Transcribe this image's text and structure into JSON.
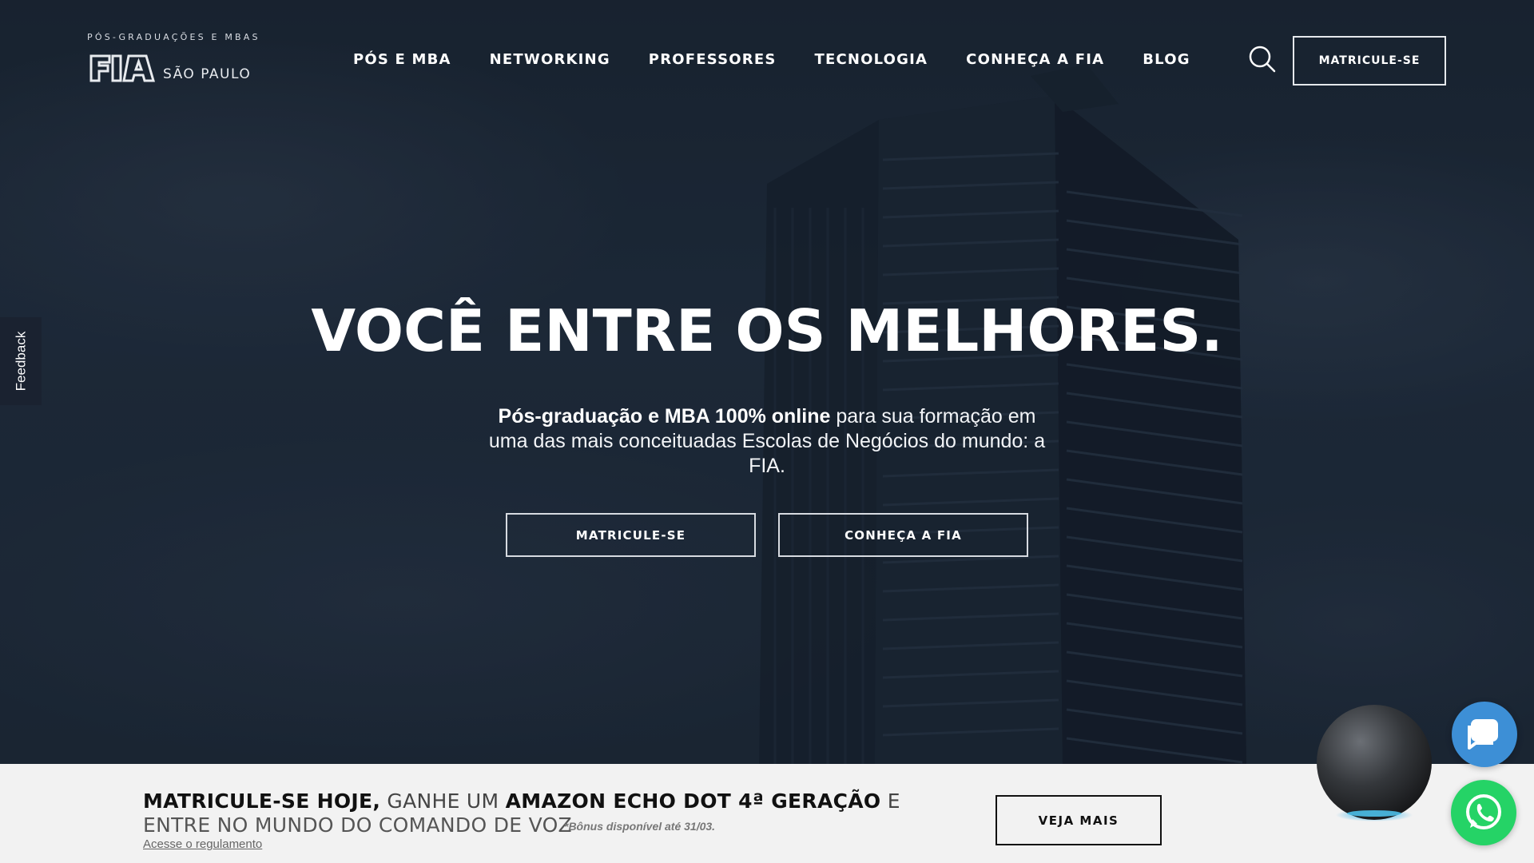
{
  "header": {
    "logo": {
      "tagline": "PÓS-GRADUAÇÕES E MBAS",
      "mark": "FIA",
      "city": "SÃO PAULO"
    },
    "nav": [
      {
        "label": "PÓS E MBA"
      },
      {
        "label": "NETWORKING"
      },
      {
        "label": "PROFESSORES"
      },
      {
        "label": "TECNOLOGIA"
      },
      {
        "label": "CONHEÇA A FIA"
      },
      {
        "label": "BLOG"
      }
    ],
    "cta_label": "MATRICULE-SE"
  },
  "feedback_label": "Feedback",
  "hero": {
    "title": "VOCÊ ENTRE OS MELHORES.",
    "subtitle_bold": "Pós-graduação e MBA 100% online",
    "subtitle_rest": " para sua formação em uma das mais conceituadas Escolas de Negócios do mundo: a FIA.",
    "primary_button": "MATRICULE-SE",
    "secondary_button": "CONHEÇA A FIA"
  },
  "promo": {
    "part1_bold": "MATRICULE-SE HOJE,",
    "part2": " GANHE UM ",
    "part3_bold": "AMAZON ECHO DOT 4ª GERAÇÃO",
    "part4": " E",
    "line2": "ENTRE NO MUNDO DO COMANDO DE VOZ",
    "note": "*Bônus disponível até 31/03.",
    "link": "Acesse o regulamento",
    "button": "VEJA MAIS"
  },
  "colors": {
    "hero_bg": "#1f2b3a",
    "banner_bg": "#f2f2f2",
    "chat_blue": "#3d8fd6",
    "whatsapp_green": "#25d366"
  },
  "icons": [
    "search-icon",
    "chat-icon",
    "whatsapp-icon"
  ]
}
